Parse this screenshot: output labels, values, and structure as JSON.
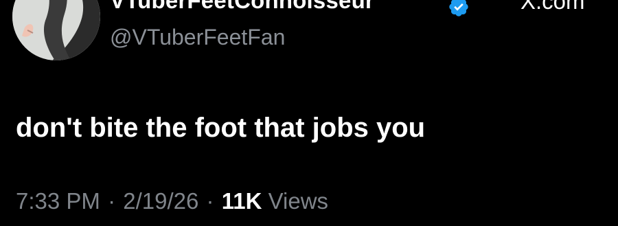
{
  "tweet": {
    "display_name": "VTuberFeetConnoisseur",
    "handle": "@VTuberFeetFan",
    "verified": true,
    "source": "X.com",
    "text": "don't bite the foot that jobs you",
    "time": "7:33 PM",
    "date": "2/19/26",
    "separator": "·",
    "views_count": "11K",
    "views_label": "Views"
  },
  "icons": {
    "avatar": "avatar-illustration",
    "verified": "verified-badge-icon"
  },
  "colors": {
    "background": "#000000",
    "primary_text": "#ffffff",
    "secondary_text": "#80858b",
    "verified_blue": "#1d9bf0"
  }
}
